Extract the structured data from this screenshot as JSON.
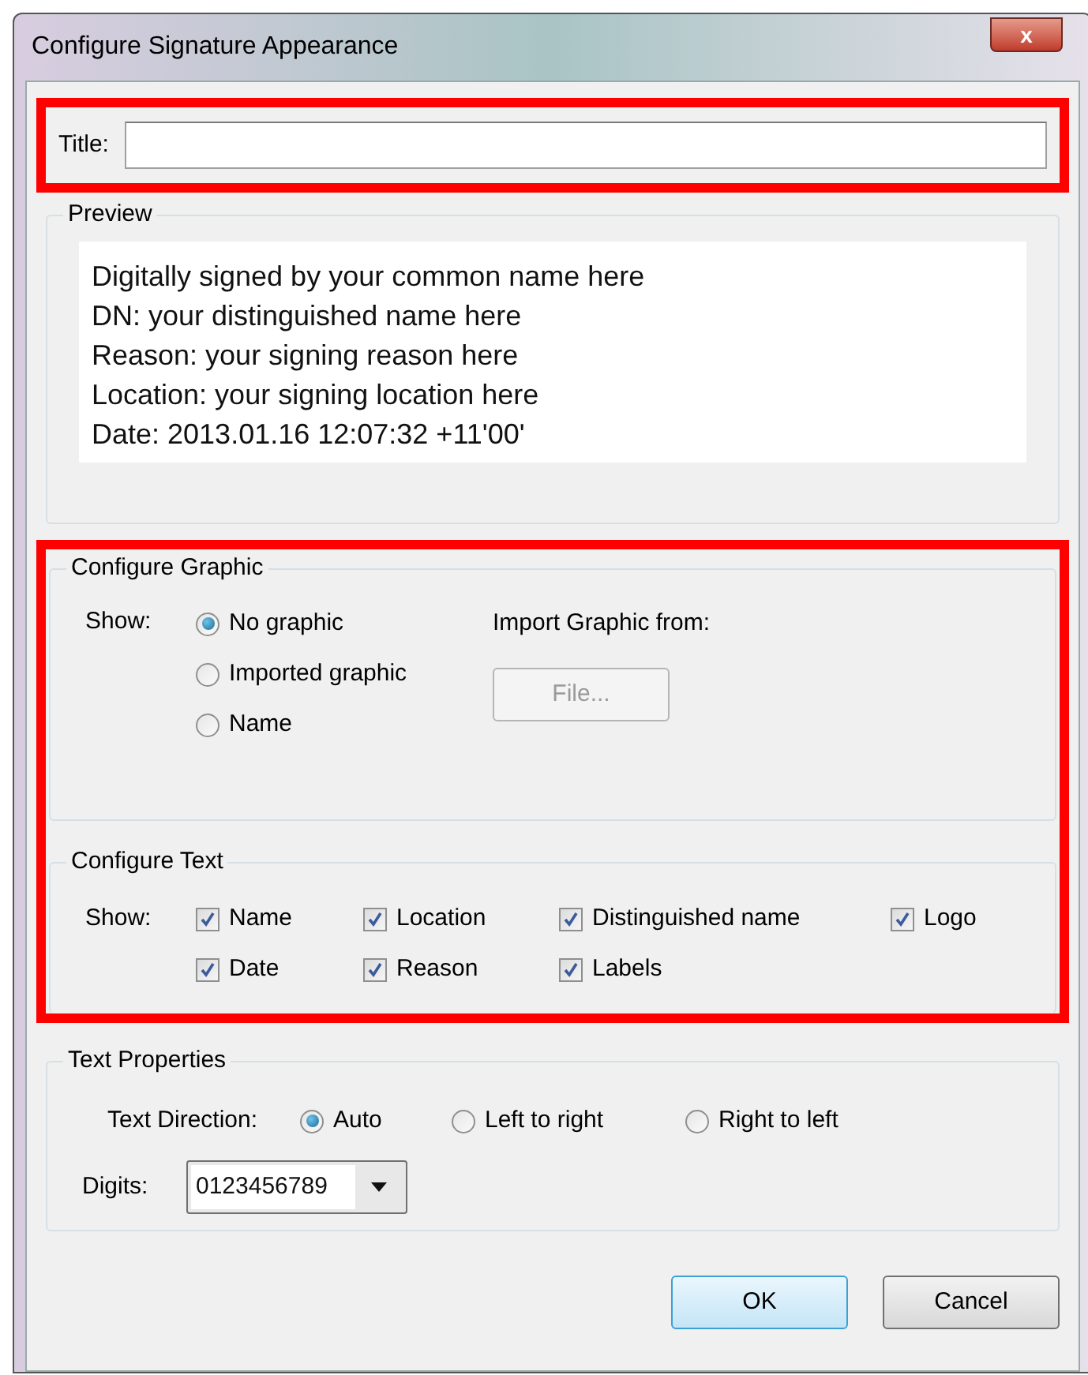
{
  "window": {
    "title": "Configure Signature Appearance",
    "close": "x"
  },
  "title_field": {
    "label": "Title:",
    "highlighted": true
  },
  "preview": {
    "legend": "Preview",
    "lines": [
      "Digitally signed by your common name here",
      "DN: your distinguished name here",
      "Reason: your signing reason here",
      "Location: your signing location here",
      "Date: 2013.01.16 12:07:32 +11'00'"
    ]
  },
  "configure_group": {
    "highlighted": true
  },
  "configure_graphic": {
    "legend": "Configure Graphic",
    "show_label": "Show:",
    "options": [
      {
        "label": "No graphic",
        "selected": true
      },
      {
        "label": "Imported graphic",
        "selected": false
      },
      {
        "label": "Name",
        "selected": false
      }
    ],
    "import_label": "Import Graphic from:",
    "file_button": {
      "label": "File...",
      "disabled": true
    }
  },
  "configure_text": {
    "legend": "Configure Text",
    "show_label": "Show:",
    "items": [
      {
        "label": "Name",
        "checked": true
      },
      {
        "label": "Location",
        "checked": true
      },
      {
        "label": "Distinguished name",
        "checked": true
      },
      {
        "label": "Logo",
        "checked": true
      },
      {
        "label": "Date",
        "checked": true
      },
      {
        "label": "Reason",
        "checked": true
      },
      {
        "label": "Labels",
        "checked": true
      }
    ]
  },
  "text_properties": {
    "legend": "Text Properties",
    "direction_label": "Text Direction:",
    "directions": [
      {
        "label": "Auto",
        "selected": true
      },
      {
        "label": "Left to right",
        "selected": false
      },
      {
        "label": "Right to left",
        "selected": false
      }
    ],
    "digits_label": "Digits:",
    "digits_value": "0123456789"
  },
  "buttons": [
    {
      "label": "OK",
      "default": true
    },
    {
      "label": "Cancel",
      "default": false
    }
  ]
}
